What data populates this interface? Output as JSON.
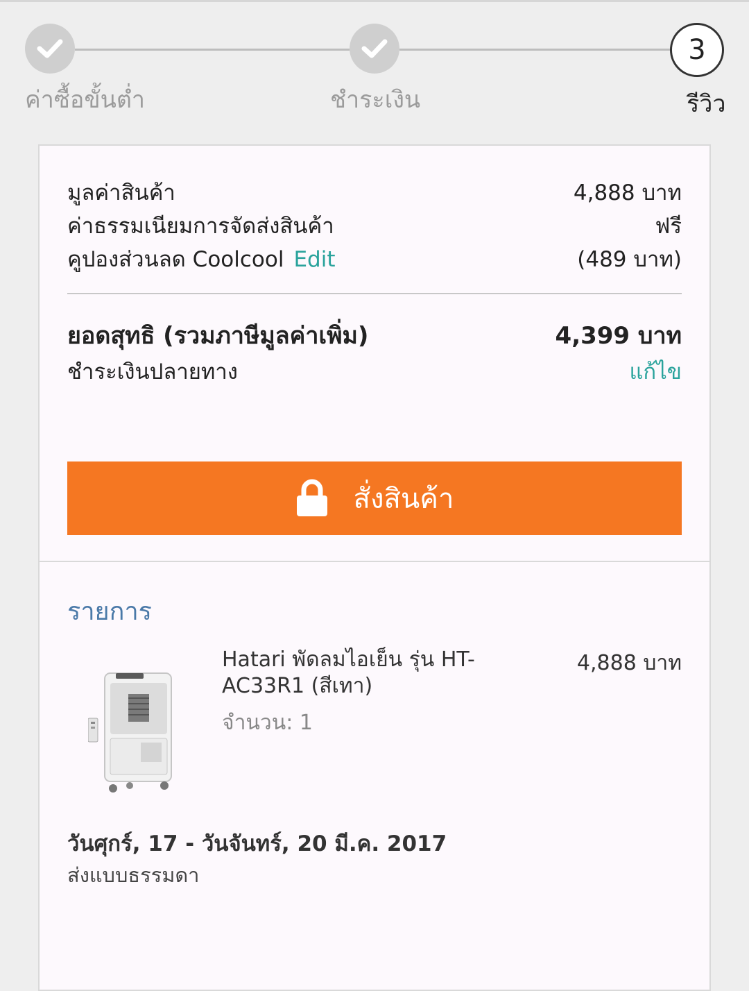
{
  "stepper": {
    "steps": [
      {
        "label": "ค่าซื้อขั้นต่ำ",
        "state": "done"
      },
      {
        "label": "ชำระเงิน",
        "state": "done"
      },
      {
        "label": "รีวิว",
        "state": "current",
        "number": "3"
      }
    ]
  },
  "summary": {
    "subtotal_label": "มูลค่าสินค้า",
    "subtotal_value": "4,888 บาท",
    "shipping_label": "ค่าธรรมเนียมการจัดส่งสินค้า",
    "shipping_value": "ฟรี",
    "coupon_label": "คูปองส่วนลด Coolcool",
    "coupon_edit": "Edit",
    "coupon_value": "(489 บาท)",
    "total_label": "ยอดสุทธิ (รวมภาษีมูลค่าเพิ่ม)",
    "total_value": "4,399 บาท",
    "payment_method": "ชำระเงินปลายทาง",
    "payment_edit": "แก้ไข",
    "order_button": "สั่งสินค้า"
  },
  "items": {
    "title": "รายการ",
    "product": {
      "name": "Hatari พัดลมไอเย็น รุ่น HT-AC33R1 (สีเทา)",
      "quantity": "จำนวน: 1",
      "price": "4,888 บาท"
    },
    "delivery_date": "วันศุกร์, 17 - วันจันทร์, 20 มี.ค. 2017",
    "delivery_method": "ส่งแบบธรรมดา"
  },
  "colors": {
    "accent_orange": "#f57722",
    "link_teal": "#2aa39c",
    "section_blue": "#4a79a8"
  },
  "icons": [
    "check-icon",
    "lock-icon"
  ]
}
